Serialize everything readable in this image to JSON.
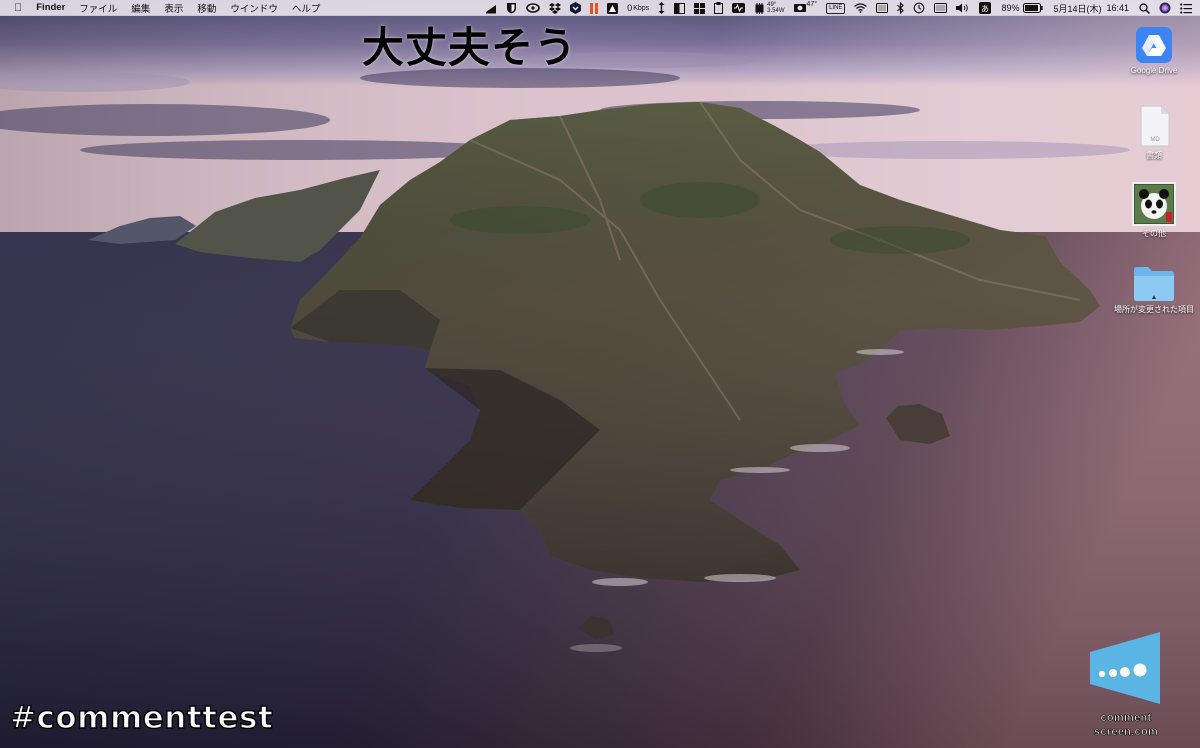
{
  "menubar": {
    "apple_icon": "apple-icon",
    "app_name": "Finder",
    "menus": [
      "ファイル",
      "編集",
      "表示",
      "移動",
      "ウインドウ",
      "ヘルプ"
    ],
    "status": {
      "network_speed": "0",
      "network_unit": "Kbps",
      "cpu_temp": "49°",
      "cpu_power": "3.54W",
      "gpu_temp": "47°",
      "battery": "89%",
      "date": "5月14日(木)",
      "time": "16:41",
      "line_label": "LINE"
    }
  },
  "overlay": {
    "comment": "大丈夫そう",
    "hashtag": "#commenttest",
    "logo_line1": "comment",
    "logo_line2": "screen.com"
  },
  "desktop": {
    "icons": [
      {
        "label": "Google Drive",
        "icon": "google-drive-icon"
      },
      {
        "label": "書類",
        "icon": "document-icon"
      },
      {
        "label": "その他",
        "icon": "panda-image-icon"
      },
      {
        "label": "場所が変更された項目",
        "icon": "folder-icon"
      }
    ]
  },
  "colors": {
    "menubar_bg": "#ece8f0",
    "sky_top": "#5b5a80",
    "sky_horizon": "#e9c7cf",
    "sea": "#2e2a48",
    "logo_blue": "#5ab4e4"
  }
}
